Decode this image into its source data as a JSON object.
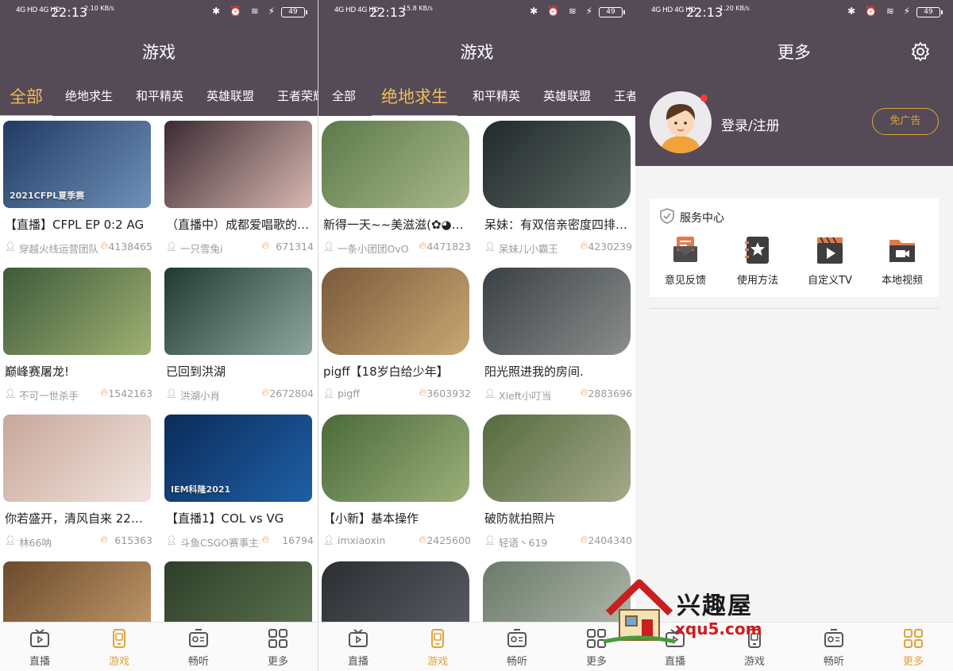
{
  "status_bars": [
    {
      "signal": "4G HD 4G HD",
      "time": "22:13",
      "speed": "2.10 KB/s",
      "icons": "✱ ⏰ ≋ ⚡",
      "battery": "49"
    },
    {
      "signal": "4G HD 4G HD",
      "time": "22:13",
      "speed": "15.8 KB/s",
      "icons": "✱ ⏰ ≋ ⚡",
      "battery": "49"
    },
    {
      "signal": "4G HD 4G HD",
      "time": "22:13",
      "speed": "1.20 KB/s",
      "icons": "✱ ⏰ ≋ ⚡",
      "battery": "49"
    }
  ],
  "screen1": {
    "title": "游戏",
    "tabs": [
      "全部",
      "绝地求生",
      "和平精英",
      "英雄联盟",
      "王者荣耀"
    ],
    "active_tab": 0,
    "cards": [
      {
        "title": "【直播】CFPL EP 0:2 AG",
        "author": "穿越火线运营团队",
        "views": "4138465",
        "thumb_label": "2021CFPL夏季赛",
        "c1": "#203a63",
        "c2": "#6f91b8"
      },
      {
        "title": "（直播中）成都爱唱歌的…",
        "author": "一只雪兔i",
        "views": "671314",
        "thumb_label": "",
        "c1": "#3b2a33",
        "c2": "#d9b8b0"
      },
      {
        "title": "巅峰赛屠龙!",
        "author": "不可一世杀手",
        "views": "1542163",
        "thumb_label": "",
        "c1": "#3d5a3a",
        "c2": "#9fb072"
      },
      {
        "title": "已回到洪湖",
        "author": "洪湖小肖",
        "views": "2672804",
        "thumb_label": "",
        "c1": "#203a30",
        "c2": "#8fa6a0"
      },
      {
        "title": "你若盛开，清风自来 22…",
        "author": "林66呐",
        "views": "615363",
        "thumb_label": "",
        "c1": "#c9a79a",
        "c2": "#efe3dc"
      },
      {
        "title": "【直播1】COL vs VG",
        "author": "斗鱼CSGO赛事主播",
        "views": "16794",
        "thumb_label": "IEM科隆2021",
        "c1": "#0b2c5a",
        "c2": "#1f5fa6"
      },
      {
        "title": "",
        "author": "",
        "views": "",
        "thumb_label": "",
        "c1": "#6b4a2c",
        "c2": "#c69e6e"
      },
      {
        "title": "",
        "author": "",
        "views": "",
        "thumb_label": "",
        "c1": "#2e3f2a",
        "c2": "#5e7550"
      }
    ]
  },
  "screen2": {
    "title": "游戏",
    "tabs": [
      "全部",
      "绝地求生",
      "和平精英",
      "英雄联盟",
      "王者荣耀"
    ],
    "active_tab": 1,
    "cards": [
      {
        "title": "新得一天~~美滋滋(✿◕‿◕…",
        "author": "一条小团团OvO",
        "views": "4471823",
        "thumb_label": "",
        "c1": "#5c7a4a",
        "c2": "#a8b88a"
      },
      {
        "title": "呆妹：有双倍亲密度四排…",
        "author": "呆妹儿小霸王",
        "views": "4230239",
        "thumb_label": "",
        "c1": "#222a2c",
        "c2": "#5d6a64"
      },
      {
        "title": "pigff【18岁白给少年】",
        "author": "pigff",
        "views": "3603932",
        "thumb_label": "",
        "c1": "#7a5a3a",
        "c2": "#c9a874"
      },
      {
        "title": "阳光照进我的房间.",
        "author": "Xleft小叮当",
        "views": "2883696",
        "thumb_label": "",
        "c1": "#3a3f44",
        "c2": "#8a8f8c"
      },
      {
        "title": "【小新】基本操作",
        "author": "imxiaoxin",
        "views": "2425600",
        "thumb_label": "",
        "c1": "#4b6a3a",
        "c2": "#9bb07a"
      },
      {
        "title": "破防就拍照片",
        "author": "轻语丶619",
        "views": "2404340",
        "thumb_label": "",
        "c1": "#566b3e",
        "c2": "#a4a98a"
      },
      {
        "title": "",
        "author": "",
        "views": "",
        "thumb_label": "",
        "c1": "#2b2e33",
        "c2": "#5c6066"
      },
      {
        "title": "",
        "author": "",
        "views": "",
        "thumb_label": "",
        "c1": "#6a7a6a",
        "c2": "#b4bcb0"
      }
    ]
  },
  "screen3": {
    "title": "更多",
    "login_text": "登录/注册",
    "adfree_label": "免广告",
    "service_title": "服务中心",
    "services": [
      {
        "label": "意见反馈",
        "icon": "feedback-icon"
      },
      {
        "label": "使用方法",
        "icon": "manual-icon"
      },
      {
        "label": "自定义TV",
        "icon": "custom-tv-icon"
      },
      {
        "label": "本地视频",
        "icon": "local-video-icon"
      }
    ]
  },
  "bottom_nav": {
    "items": [
      "直播",
      "游戏",
      "畅听",
      "更多"
    ],
    "active": [
      1,
      1,
      3
    ]
  },
  "watermark": {
    "text": "兴趣屋",
    "url": "xqu5.com"
  },
  "colors": {
    "header": "#544b57",
    "accent": "#f3bb5c",
    "fire": "#f5a34a"
  }
}
